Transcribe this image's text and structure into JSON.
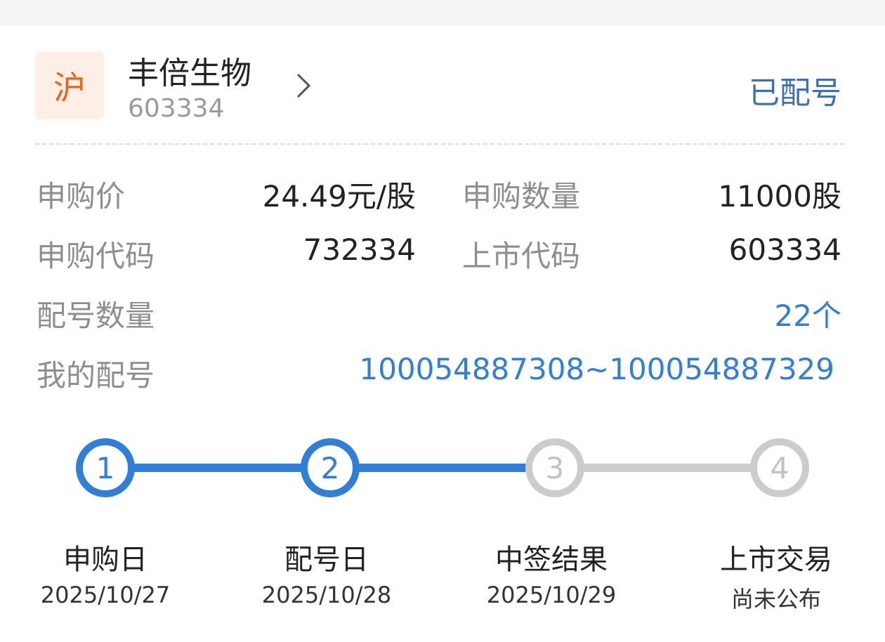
{
  "stock": {
    "market": "沪",
    "name": "丰倍生物",
    "code": "603334",
    "status": "已配号"
  },
  "details": {
    "price_label": "申购价",
    "price_value": "24.49元/股",
    "qty_label": "申购数量",
    "qty_value": "11000股",
    "sub_code_label": "申购代码",
    "sub_code_value": "732334",
    "list_code_label": "上市代码",
    "list_code_value": "603334",
    "alloc_count_label": "配号数量",
    "alloc_count_value": "22个",
    "my_alloc_label": "我的配号",
    "my_alloc_value": "100054887308~100054887329"
  },
  "steps": [
    {
      "num": "1",
      "name": "申购日",
      "date": "2025/10/27",
      "active": true
    },
    {
      "num": "2",
      "name": "配号日",
      "date": "2025/10/28",
      "active": true
    },
    {
      "num": "3",
      "name": "中签结果",
      "date": "2025/10/29",
      "active": false
    },
    {
      "num": "4",
      "name": "上市交易",
      "date": "尚未公布",
      "active": false
    }
  ],
  "colors": {
    "accent": "#2f7ed8",
    "status": "#3d6fb5",
    "market_badge_bg": "#fdeee6",
    "market_badge_text": "#e8631f",
    "inactive": "#cccccc"
  },
  "icons": {
    "chevron": "chevron-right-icon"
  }
}
